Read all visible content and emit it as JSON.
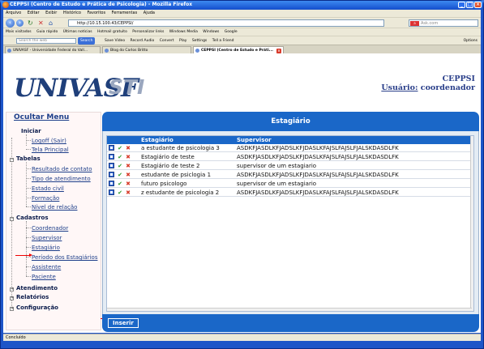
{
  "browser": {
    "title": "CEPPSI (Centro de Estudo e Prática de Psicologia) - Mozilla Firefox",
    "menu": [
      "Arquivo",
      "Editar",
      "Exibir",
      "Histórico",
      "Favoritos",
      "Ferramentas",
      "Ajuda"
    ],
    "url": "http://10.15.100.43/CEPPSI/",
    "search_placeholder": "Ask.com",
    "bookmarks": [
      "Mais visitados",
      "Guia rápido",
      "Últimas notícias",
      "Hotmail gratuito",
      "Personalizar links",
      "Windows Media",
      "Windows",
      "Google"
    ],
    "toolbar_search_placeholder": "Search the web",
    "toolbar_search_button": "Search",
    "toolbar_items": [
      "Save Video",
      "Record Audio",
      "Convert",
      "Play",
      "Settings",
      "Tell a Friend"
    ],
    "toolbar_options": "Options",
    "tabs": [
      {
        "label": "UNIVASF - Universidade Federal do Vall...",
        "active": false
      },
      {
        "label": "Blog do Carlos Britto",
        "active": false
      },
      {
        "label": "CEPPSI (Centro de Estudo e Práti...",
        "active": true
      }
    ],
    "status": "Concluído"
  },
  "header": {
    "logo_left": "UNIVASF",
    "logo_right": "STI",
    "system": "CEPPSI",
    "user_label": "Usuário:",
    "user_name": "coordenador"
  },
  "sidebar": {
    "toggle": "Ocultar Menu",
    "iniciar": "Iniciar",
    "iniciar_items": [
      "Logoff (Sair)",
      "Tela Principal"
    ],
    "tabelas": "Tabelas",
    "tabelas_items": [
      "Resultado de contato",
      "Tipo de atendimento",
      "Estado civil",
      "Formação",
      "Nível de relação"
    ],
    "cadastros": "Cadastros",
    "cadastros_items": [
      "Coordenador",
      "Supervisor",
      "Estagiário",
      "Período dos Estagiários",
      "Assistente",
      "Paciente"
    ],
    "atendimento": "Atendimento",
    "relatorios": "Relatórios",
    "configuracao": "Configuração"
  },
  "panel": {
    "title": "Estagiário",
    "columns": [
      "Estagiário",
      "Supervisor"
    ],
    "rows": [
      {
        "estagiario": "a estudante de psicologia 3",
        "supervisor": "ASDKFJASDLKFJADSLKFJDASLKFAJSLFAJSLFJALSKDASDLFK"
      },
      {
        "estagiario": "Estagiário de teste",
        "supervisor": "ASDKFJASDLKFJADSLKFJDASLKFAJSLFAJSLFJALSKDASDLFK"
      },
      {
        "estagiario": "Estagiário de teste 2",
        "supervisor": "supervisor de um estagiario"
      },
      {
        "estagiario": "estudante de psiclogia 1",
        "supervisor": "ASDKFJASDLKFJADSLKFJDASLKFAJSLFAJSLFJALSKDASDLFK"
      },
      {
        "estagiario": "futuro psicologo",
        "supervisor": "supervisor de um estagiario"
      },
      {
        "estagiario": "z estudante de psicologia 2",
        "supervisor": "ASDKFJASDLKFJADSLKFJDASLKFAJSLFAJSLFJALSKDASDLFK"
      }
    ],
    "insert_button": "Inserir"
  },
  "colors": {
    "accent": "#1a67c8",
    "annotation_arrow": "#e00000"
  },
  "icons": [
    "firefox-icon",
    "back-icon",
    "forward-icon",
    "reload-icon",
    "stop-icon",
    "home-icon",
    "view-icon",
    "edit-check-icon",
    "delete-x-icon"
  ]
}
